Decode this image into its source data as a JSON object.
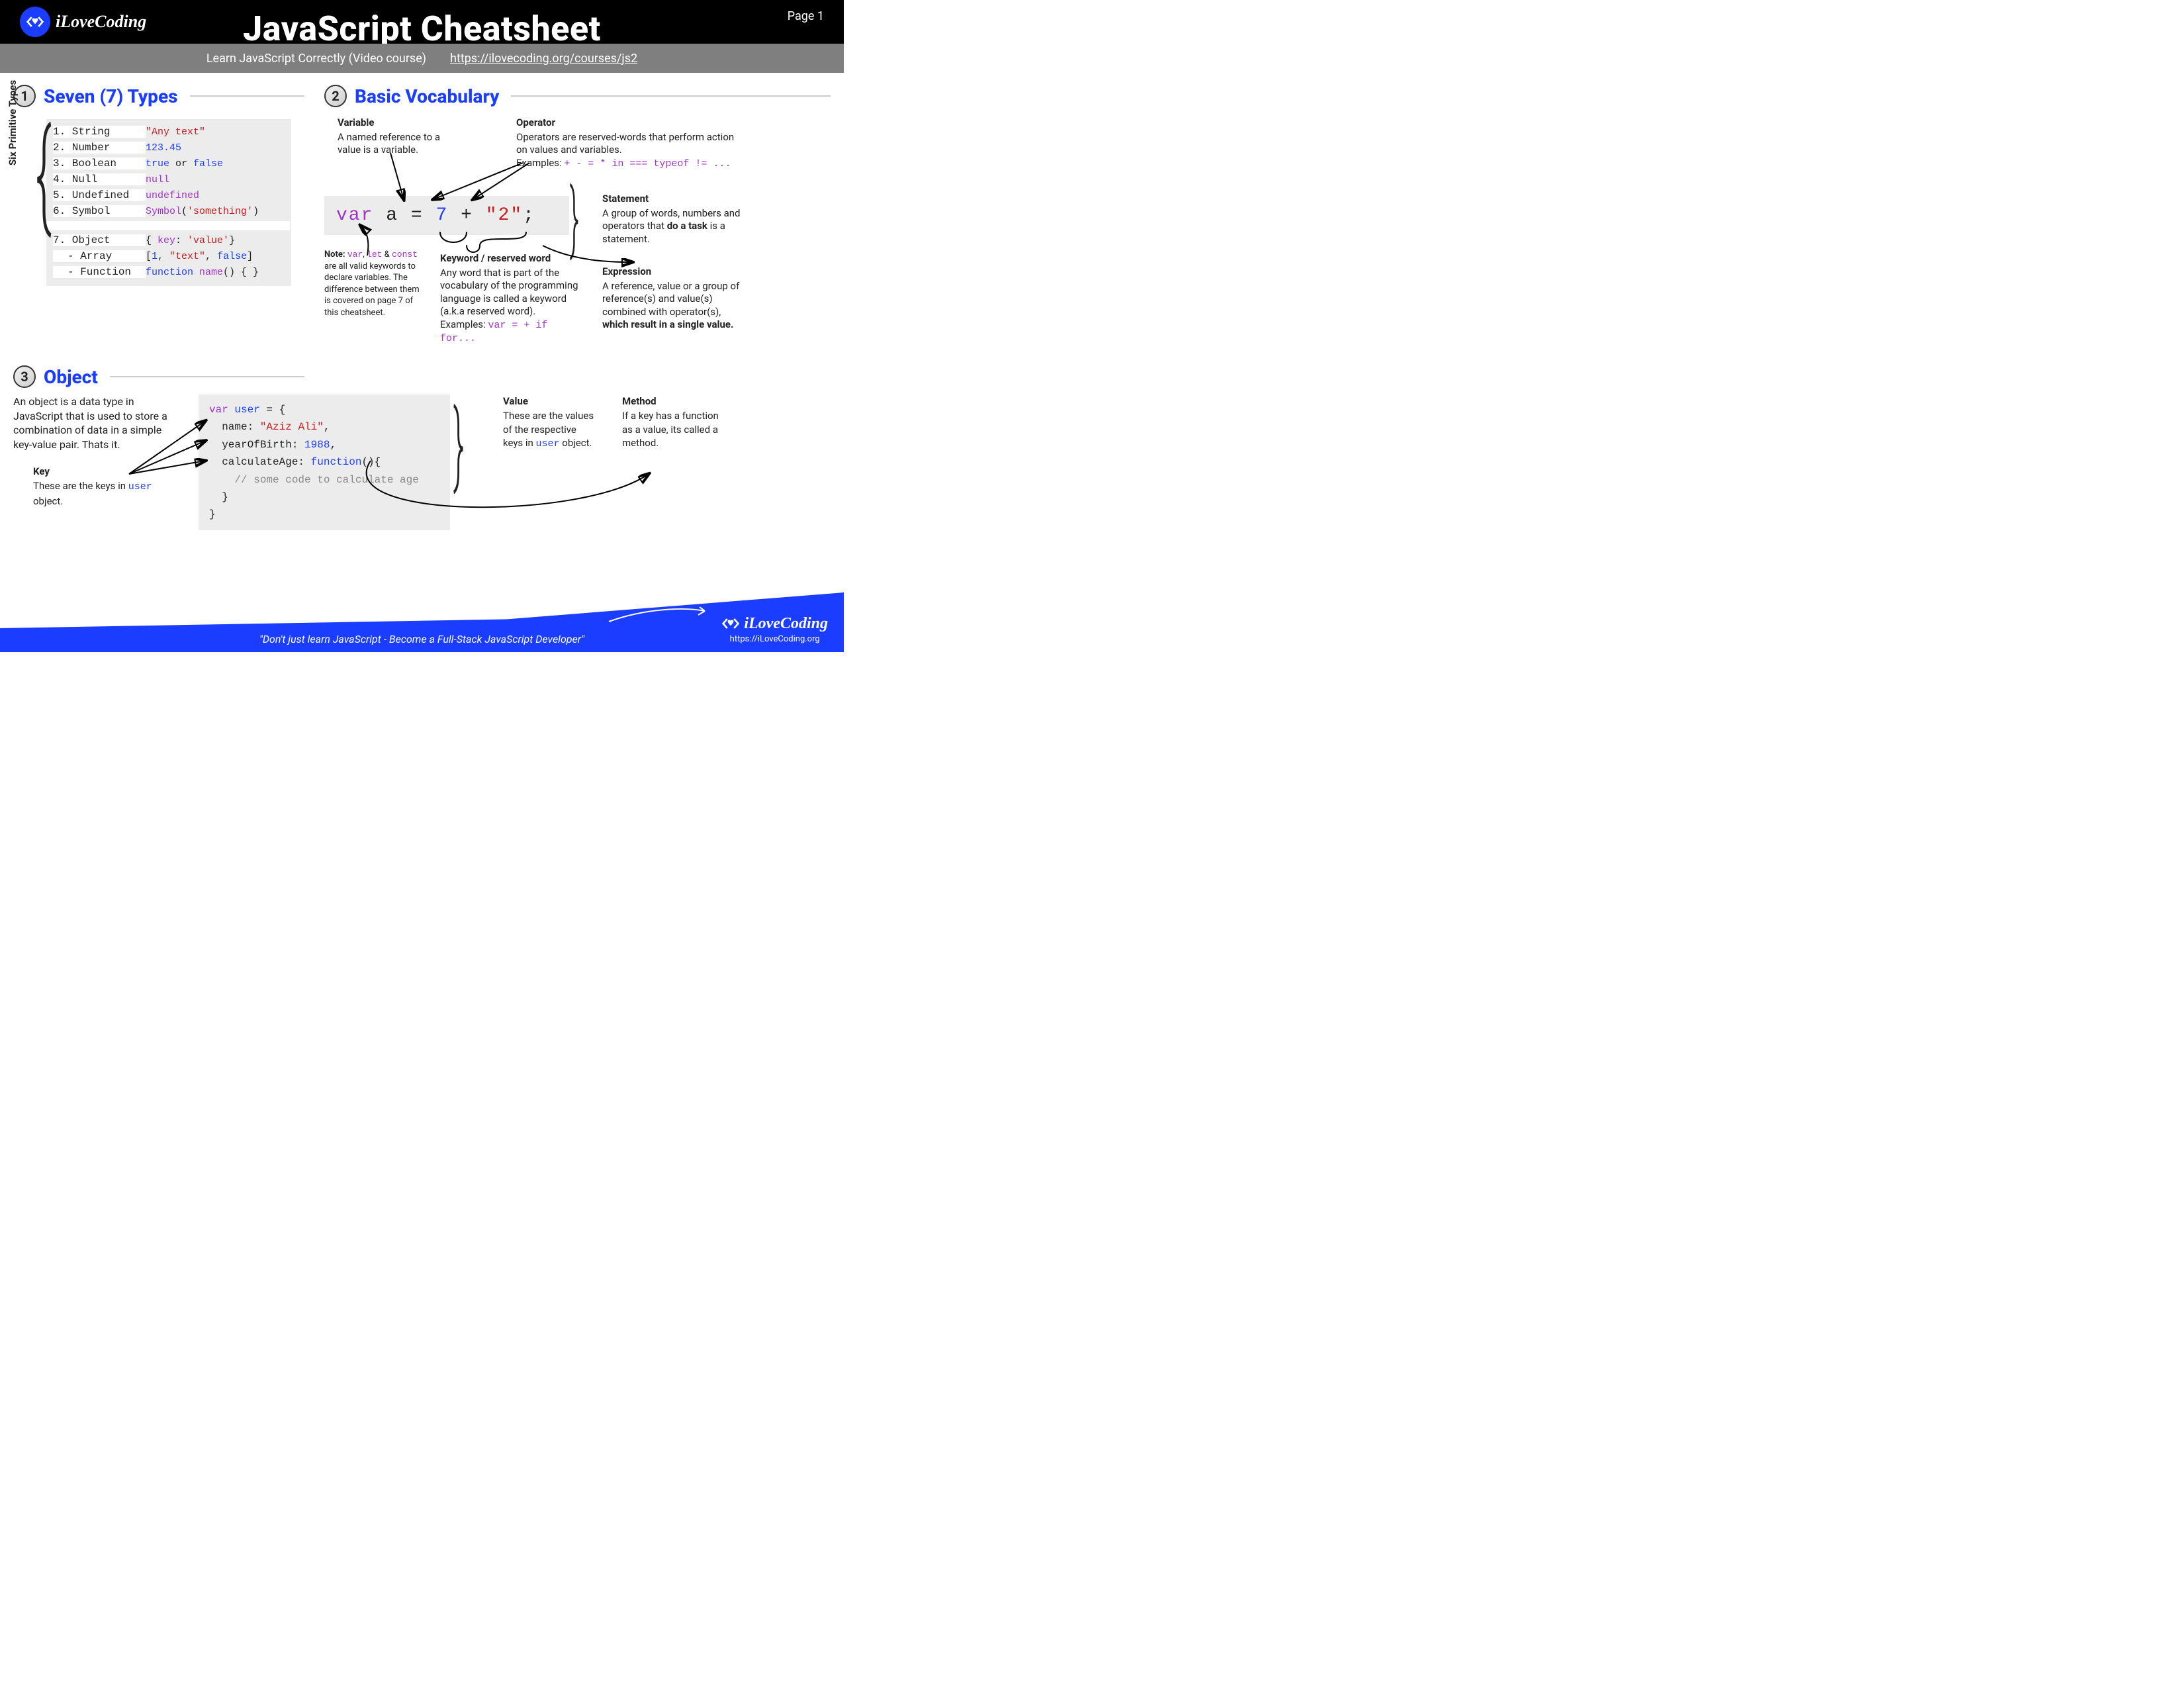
{
  "header": {
    "brand": "iLoveCoding",
    "title": "JavaScript Cheatsheet",
    "page": "Page 1",
    "subtitle": "Learn JavaScript Correctly (Video course)",
    "link": "https://ilovecoding.org/courses/js2"
  },
  "s1": {
    "num": "1",
    "title": "Seven (7) Types",
    "sideLabel": "Six Primitive Types",
    "rows": [
      {
        "n": "1.  String",
        "c": "\"Any text\"",
        "cls": "red"
      },
      {
        "n": "2.  Number",
        "c": "123.45",
        "cls": "blue"
      },
      {
        "n": "3.  Boolean",
        "c": "true or false",
        "cls": "bool"
      },
      {
        "n": "4.  Null",
        "c": "null",
        "cls": "purple"
      },
      {
        "n": "5.  Undefined",
        "c": "undefined",
        "cls": "purple"
      },
      {
        "n": "6.  Symbol",
        "c": "Symbol('something')",
        "cls": "sym"
      }
    ],
    "objRow": {
      "n": "7.  Object",
      "c": "{ key: 'value'}"
    },
    "arrRow": {
      "n": "   -  Array",
      "c": "[1, \"text\", false]"
    },
    "fnRow": {
      "n": "   -  Function",
      "c": "function name() { }"
    }
  },
  "s2": {
    "num": "2",
    "title": "Basic Vocabulary",
    "variable": {
      "h": "Variable",
      "t": "A named reference to a value is a variable."
    },
    "operator": {
      "h": "Operator",
      "t": "Operators are reserved-words that perform action on values and variables.",
      "ex": "Examples: ",
      "exCode": "+ - = * in === typeof != ..."
    },
    "statement": {
      "h": "Statement",
      "t1": "A group of words, numbers and operators that ",
      "t2": "do a task",
      "t3": " is a statement."
    },
    "note": {
      "h": "Note: ",
      "code1": "var",
      "code2": "let",
      "code3": "const",
      "t": " are all valid keywords to declare variables. The difference between them is covered on page 7 of this cheatsheet."
    },
    "keyword": {
      "h": "Keyword / reserved word",
      "t": "Any word that is part of the vocabulary of the programming language is called a keyword (a.k.a reserved word).",
      "ex": "Examples: ",
      "exCode": "var = + if for..."
    },
    "expression": {
      "h": "Expression",
      "t1": "A reference, value or a group of reference(s) and value(s) combined with operator(s), ",
      "t2": "which result in a single value."
    },
    "code": {
      "var": "var",
      "a": "a",
      "eq": "=",
      "seven": "7",
      "plus": "+",
      "two": "\"2\"",
      "semi": ";"
    }
  },
  "s3": {
    "num": "3",
    "title": "Object",
    "intro": "An object is a data type in JavaScript that is used to store a combination of data in a simple key-value pair. Thats it.",
    "key": {
      "h": "Key",
      "t1": "These are the keys in ",
      "u": "user",
      "t2": " object."
    },
    "value": {
      "h": "Value",
      "t1": "These are the values of the respective keys in ",
      "u": "user",
      "t2": " object."
    },
    "method": {
      "h": "Method",
      "t": "If a key has a function as a value, its called a method."
    },
    "code": {
      "l1a": "var",
      "l1b": "user",
      "l1c": " = {",
      "l2a": "name:",
      "l2b": "\"Aziz Ali\"",
      "l2c": ",",
      "l3a": "yearOfBirth:",
      "l3b": "1988",
      "l3c": ",",
      "l4a": "calculateAge:",
      "l4b": "function",
      "l4c": "(){",
      "l5": "// some code to calculate age",
      "l6": "}",
      "l7": "}"
    }
  },
  "footer": {
    "tag": "\"Don't just learn JavaScript - Become a Full-Stack JavaScript Developer\"",
    "brand": "iLoveCoding",
    "url": "https://iLoveCoding.org"
  }
}
